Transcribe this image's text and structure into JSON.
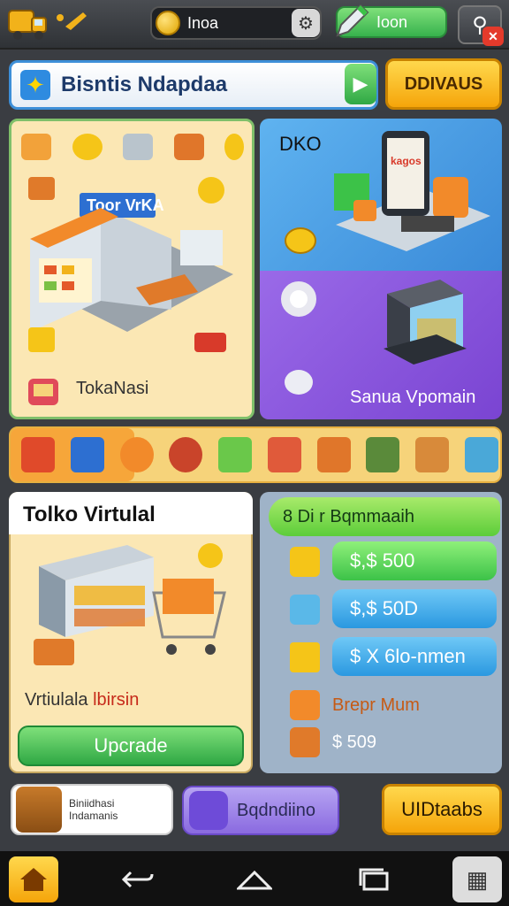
{
  "topbar": {
    "coins_value": "Inoa",
    "green_value": "Ioon"
  },
  "banner": {
    "title": "Bisntis Ndapdaa",
    "action_label": "DDIVAUS"
  },
  "panel_shop": {
    "sign_text": "Toor VrKA",
    "label": "TokaNasi"
  },
  "panel_pc": {
    "title": "DKO",
    "screen_text": "kagos"
  },
  "panel_store": {
    "label": "Sanua Vpomain"
  },
  "virtual_store": {
    "title": "Tolko Virtulal",
    "sub_black": "Vrtiulala",
    "sub_red": "lbirsin",
    "upgrade_label": "Upcrade"
  },
  "price_panel": {
    "header": "8 Di  r Bqmmaaih",
    "rows": [
      {
        "label": "$,$ 500"
      },
      {
        "label": "$,$ 50D"
      },
      {
        "label": "$ X 6lo-nmen"
      }
    ],
    "orange_text": "Brepr Mum",
    "price_text": "$ 509"
  },
  "bottom": {
    "card1_line1": "Biniidhasi",
    "card1_line2": "Indamanis",
    "card2_label": "Bqdndiino",
    "card3_label": "UIDtaabs"
  },
  "colors": {
    "accent_green": "#37b24d",
    "accent_orange": "#f5a50a",
    "accent_blue": "#2a98e0",
    "accent_purple": "#7a44d2"
  }
}
